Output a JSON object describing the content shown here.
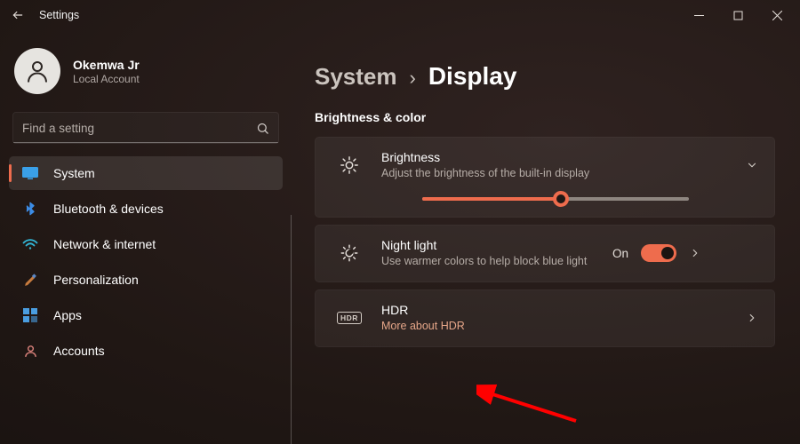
{
  "window": {
    "title": "Settings"
  },
  "profile": {
    "name": "Okemwa Jr",
    "subtitle": "Local Account"
  },
  "search": {
    "placeholder": "Find a setting"
  },
  "nav": {
    "items": [
      {
        "id": "system",
        "label": "System"
      },
      {
        "id": "bluetooth",
        "label": "Bluetooth & devices"
      },
      {
        "id": "network",
        "label": "Network & internet"
      },
      {
        "id": "personalization",
        "label": "Personalization"
      },
      {
        "id": "apps",
        "label": "Apps"
      },
      {
        "id": "accounts",
        "label": "Accounts"
      }
    ],
    "active": "system"
  },
  "breadcrumb": {
    "parent": "System",
    "separator": "›",
    "current": "Display"
  },
  "section": {
    "title": "Brightness & color"
  },
  "cards": {
    "brightness": {
      "title": "Brightness",
      "subtitle": "Adjust the brightness of the built-in display",
      "slider_percent": 52
    },
    "nightlight": {
      "title": "Night light",
      "subtitle": "Use warmer colors to help block blue light",
      "state_label": "On",
      "on": true
    },
    "hdr": {
      "title": "HDR",
      "link_text": "More about HDR",
      "badge": "HDR"
    }
  }
}
